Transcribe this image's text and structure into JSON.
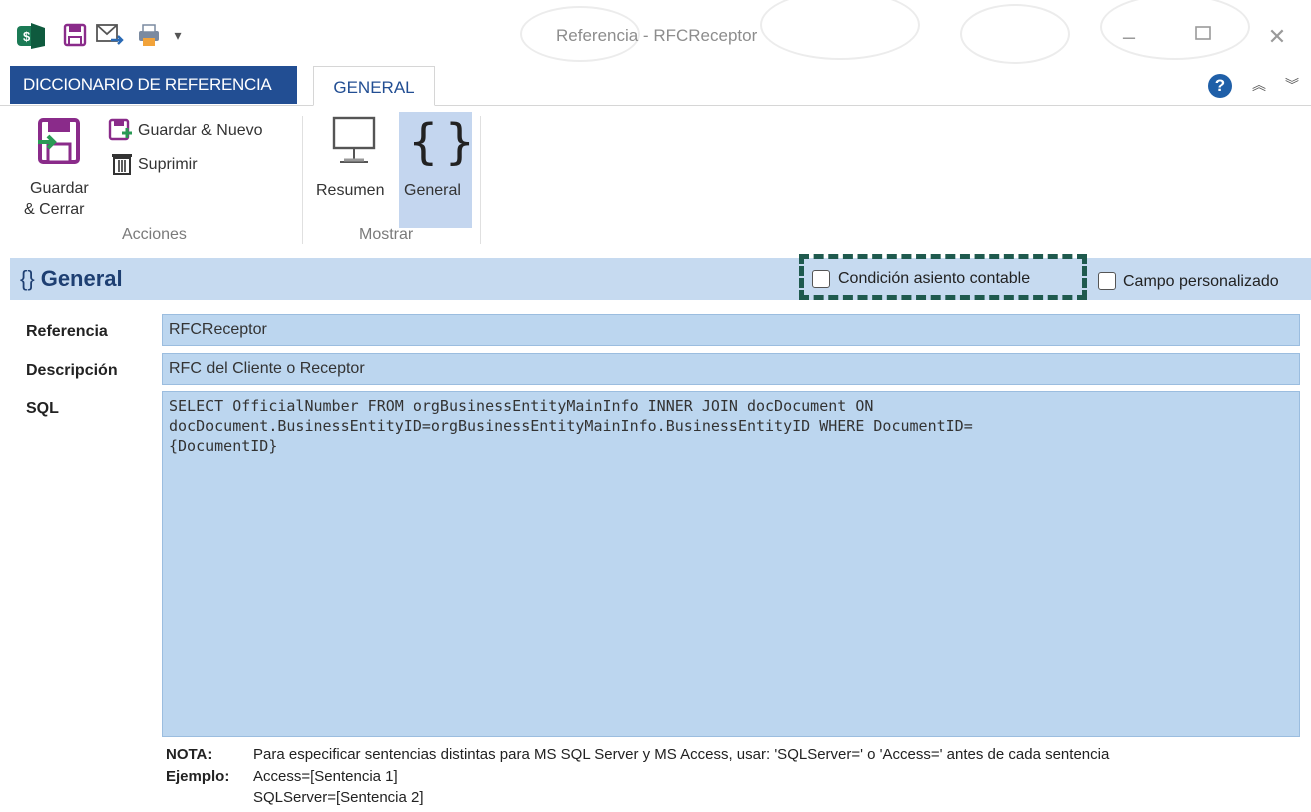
{
  "window": {
    "title": "Referencia - RFCReceptor"
  },
  "tabs": {
    "file_tab": "DICCIONARIO DE REFERENCIA",
    "active_tab": "GENERAL"
  },
  "ribbon": {
    "acciones": {
      "group_label": "Acciones",
      "save_close_line1": "Guardar",
      "save_close_line2": "& Cerrar",
      "save_new": "Guardar & Nuevo",
      "delete": "Suprimir"
    },
    "mostrar": {
      "group_label": "Mostrar",
      "summary": "Resumen",
      "general": "General"
    }
  },
  "section": {
    "braces": "{}",
    "title": "General",
    "checkbox_accounting": "Condición asiento contable",
    "checkbox_custom": "Campo personalizado"
  },
  "form": {
    "ref_label": "Referencia",
    "ref_value": "RFCReceptor",
    "desc_label": "Descripción",
    "desc_value": "RFC del Cliente o Receptor",
    "sql_label": "SQL",
    "sql_value": "SELECT OfficialNumber FROM orgBusinessEntityMainInfo INNER JOIN docDocument ON\ndocDocument.BusinessEntityID=orgBusinessEntityMainInfo.BusinessEntityID WHERE DocumentID=\n{DocumentID}"
  },
  "note": {
    "nota_label": "NOTA:",
    "nota_text": "Para especificar sentencias distintas para MS SQL Server y MS Access, usar: 'SQLServer=' o 'Access=' antes de cada sentencia",
    "ejemplo_label": "Ejemplo:",
    "ejemplo_line1": "Access=[Sentencia 1]",
    "ejemplo_line2": "SQLServer=[Sentencia 2]"
  }
}
